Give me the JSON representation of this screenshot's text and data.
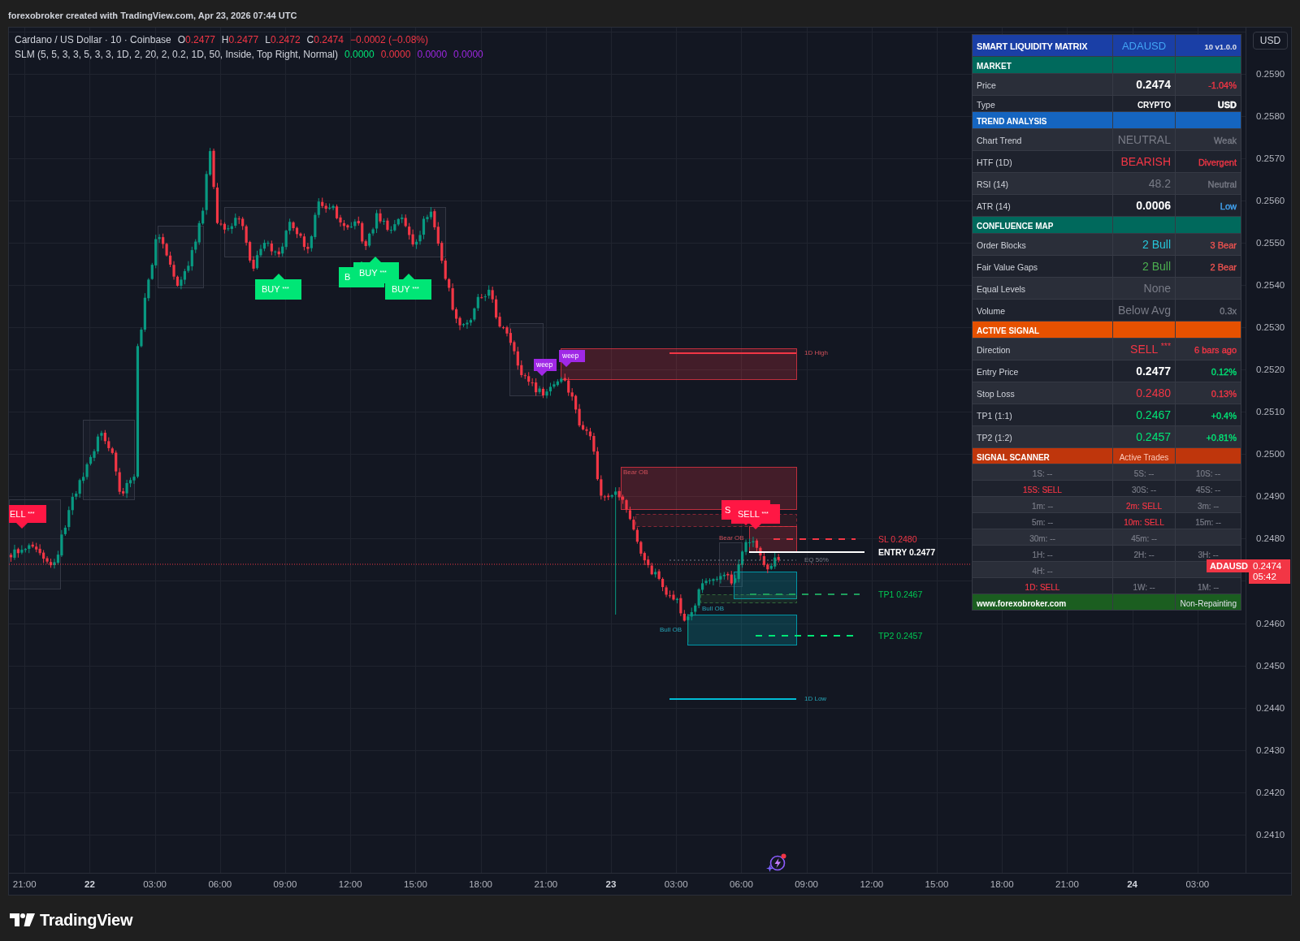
{
  "attribution": "forexobroker created with TradingView.com, Apr 23, 2026 07:44 UTC",
  "legend": {
    "symbol": "Cardano / US Dollar · 10 · Coinbase",
    "bearish": true,
    "ohlc": [
      {
        "key": "O",
        "value": "0.2477"
      },
      {
        "key": "H",
        "value": "0.2477"
      },
      {
        "key": "L",
        "value": "0.2472"
      },
      {
        "key": "C",
        "value": "0.2474"
      }
    ],
    "change": "−0.0002 (−0.08%)",
    "indicator": "SLM (5, 5, 3, 3, 5, 3, 3, 1D, 2, 20, 2, 0.2, 1D, 50, Inside, Top Right, Normal)",
    "indicator_values": [
      {
        "value": "0.0000",
        "color": "#00e676"
      },
      {
        "value": "0.0000",
        "color": "#f23645"
      },
      {
        "value": "0.0000",
        "color": "#9c27e0"
      },
      {
        "value": "0.0000",
        "color": "#9c27e0"
      }
    ]
  },
  "signal_labels": [
    {
      "kind": "sell",
      "text": "ELL $^{***}$"
    },
    {
      "kind": "buy",
      "text": "BUY $^{***}$"
    },
    {
      "kind": "buy",
      "text": "B"
    },
    {
      "kind": "buy",
      "text": "BUY $^{***}$"
    },
    {
      "kind": "buy",
      "text": "BUY $^{***}$"
    },
    {
      "kind": "sweep",
      "text": "weep"
    },
    {
      "kind": "sweep",
      "text": "weep"
    },
    {
      "kind": "sell",
      "text": "S"
    },
    {
      "kind": "sell",
      "text": "SELL $^{***}$"
    }
  ],
  "zone_labels": [
    {
      "kind": "bearish",
      "text": "1D High"
    },
    {
      "kind": "bearish",
      "text": "Bear OB"
    },
    {
      "kind": "bearish",
      "text": "Bear OB"
    },
    {
      "kind": "neutral",
      "text": "EQ 50%"
    },
    {
      "kind": "bullish",
      "text": "Bull OB"
    },
    {
      "kind": "bullish",
      "text": "Bull OB"
    },
    {
      "kind": "bullish",
      "text": "1D Low"
    }
  ],
  "trade_levels": [
    {
      "kind": "stop",
      "text": "SL 0.2480"
    },
    {
      "kind": "entry",
      "text": "ENTRY 0.2477"
    },
    {
      "kind": "target",
      "text": "TP1 0.2467"
    },
    {
      "kind": "target",
      "text": "TP2 0.2457"
    }
  ],
  "dashboard": {
    "title": "SMART LIQUIDITY MATRIX",
    "symbol": "ADAUSD",
    "version": "10 v1.0.0",
    "sections": [
      {
        "title": "MARKET",
        "color": "#00695c",
        "rows": [
          {
            "label": "Price",
            "kind": "metric",
            "value": {
              "text": "0.2474",
              "color": "#ffffff",
              "bold": true
            },
            "note": {
              "text": "-1.04%",
              "color": "#f23645"
            }
          },
          {
            "label": "Type",
            "kind": "info",
            "value": {
              "text": "CRYPTO",
              "color": "#ffffff",
              "bold": true
            },
            "note": {
              "text": "USD",
              "color": "#ffffff"
            }
          }
        ]
      },
      {
        "title": "TREND ANALYSIS",
        "color": "#1565c0",
        "rows": [
          {
            "label": "Chart Trend",
            "kind": "metric",
            "value": {
              "text": "NEUTRAL",
              "color": "#787b86",
              "bold": false
            },
            "note": {
              "text": "Weak",
              "color": "#787b86"
            }
          },
          {
            "label": "HTF (1D)",
            "kind": "metric",
            "value": {
              "text": "BEARISH",
              "color": "#f23645",
              "bold": false
            },
            "note": {
              "text": "Divergent",
              "color": "#f23645"
            }
          },
          {
            "label": "RSI (14)",
            "kind": "metric",
            "value": {
              "text": "48.2",
              "color": "#787b86",
              "bold": false
            },
            "note": {
              "text": "Neutral",
              "color": "#787b86"
            }
          },
          {
            "label": "ATR (14)",
            "kind": "metric",
            "value": {
              "text": "0.0006",
              "color": "#ffffff",
              "bold": true
            },
            "note": {
              "text": "Low",
              "color": "#42a5f5"
            }
          }
        ]
      },
      {
        "title": "CONFLUENCE MAP",
        "color": "#00695c",
        "rows": [
          {
            "label": "Order Blocks",
            "kind": "metric",
            "value": {
              "text": "2 Bull",
              "color": "#26c6da",
              "bold": false
            },
            "note": {
              "text": "3 Bear",
              "color": "#ef5350"
            }
          },
          {
            "label": "Fair Value Gaps",
            "kind": "metric",
            "value": {
              "text": "2 Bull",
              "color": "#4caf50",
              "bold": false
            },
            "note": {
              "text": "2 Bear",
              "color": "#ef5350"
            }
          },
          {
            "label": "Equal Levels",
            "kind": "metric",
            "value": {
              "text": "None",
              "color": "#787b86",
              "bold": false
            }
          },
          {
            "label": "Volume",
            "kind": "metric",
            "value": {
              "text": "Below Avg",
              "color": "#787b86",
              "bold": false
            },
            "note": {
              "text": "0.3x",
              "color": "#787b86"
            }
          }
        ]
      },
      {
        "title": "ACTIVE SIGNAL",
        "color": "#e65100",
        "rows": [
          {
            "label": "Direction",
            "kind": "metric",
            "value": {
              "text": "SELL $^{***}$",
              "color": "#f23645",
              "bold": false
            },
            "note": {
              "text": "6 bars ago",
              "color": "#f23645"
            }
          },
          {
            "label": "Entry Price",
            "kind": "metric",
            "value": {
              "text": "0.2477",
              "color": "#ffffff",
              "bold": true
            },
            "note": {
              "text": "0.12%",
              "color": "#00e676"
            }
          },
          {
            "label": "Stop Loss",
            "kind": "metric",
            "value": {
              "text": "0.2480",
              "color": "#f23645",
              "bold": false
            },
            "note": {
              "text": "0.13%",
              "color": "#f23645"
            }
          },
          {
            "label": "TP1 (1:1)",
            "kind": "metric",
            "value": {
              "text": "0.2467",
              "color": "#00e676",
              "bold": false
            },
            "note": {
              "text": "+0.4%",
              "color": "#00e676"
            }
          },
          {
            "label": "TP2 (1:2)",
            "kind": "metric",
            "value": {
              "text": "0.2457",
              "color": "#00e676",
              "bold": false
            },
            "note": {
              "text": "+0.81%",
              "color": "#00e676"
            }
          }
        ]
      },
      {
        "title": "SIGNAL SCANNER",
        "subtitle": "Active Trades",
        "color": "#bf360c",
        "scanner": [
          [
            {
              "text": "1S: --",
              "color": "#787b86"
            },
            {
              "text": "5S: --",
              "color": "#787b86"
            },
            {
              "text": "10S: --",
              "color": "#787b86"
            }
          ],
          [
            {
              "text": "15S: SELL",
              "color": "#f23645"
            },
            {
              "text": "30S: --",
              "color": "#787b86"
            },
            {
              "text": "45S: --",
              "color": "#787b86"
            }
          ],
          [
            {
              "text": "1m: --",
              "color": "#787b86"
            },
            {
              "text": "2m: SELL",
              "color": "#f23645"
            },
            {
              "text": "3m: --",
              "color": "#787b86"
            }
          ],
          [
            {
              "text": "5m: --",
              "color": "#787b86"
            },
            {
              "text": "10m: SELL",
              "color": "#f23645"
            },
            {
              "text": "15m: --",
              "color": "#787b86"
            }
          ],
          [
            {
              "text": "30m: --",
              "color": "#787b86"
            },
            {
              "text": "45m: --",
              "color": "#787b86"
            }
          ],
          [
            {
              "text": "1H: --",
              "color": "#787b86"
            },
            {
              "text": "2H: --",
              "color": "#787b86"
            },
            {
              "text": "3H: --",
              "color": "#787b86"
            }
          ],
          [
            {
              "text": "4H: --",
              "color": "#787b86"
            }
          ],
          [
            {
              "text": "1D: SELL",
              "color": "#f23645"
            },
            {
              "text": "1W: --",
              "color": "#787b86"
            },
            {
              "text": "1M: --",
              "color": "#787b86"
            }
          ]
        ]
      }
    ],
    "footer": {
      "left": "www.forexobroker.com",
      "right": "Non-Repainting"
    }
  },
  "price_axis": {
    "currency": "USD",
    "labels": [
      "0.2590",
      "0.2580",
      "0.2570",
      "0.2560",
      "0.2550",
      "0.2540",
      "0.2530",
      "0.2520",
      "0.2510",
      "0.2500",
      "0.2490",
      "0.2480",
      "0.2460",
      "0.2450",
      "0.2440",
      "0.2430",
      "0.2420",
      "0.2410"
    ],
    "symbol_tag": "ADAUSD",
    "price": "0.2474",
    "countdown": "05:42"
  },
  "time_axis": {
    "labels": [
      {
        "text": "21:00",
        "kind": "time"
      },
      {
        "text": "22",
        "kind": "day"
      },
      {
        "text": "03:00",
        "kind": "time"
      },
      {
        "text": "06:00",
        "kind": "time"
      },
      {
        "text": "09:00",
        "kind": "time"
      },
      {
        "text": "12:00",
        "kind": "time"
      },
      {
        "text": "15:00",
        "kind": "time"
      },
      {
        "text": "18:00",
        "kind": "time"
      },
      {
        "text": "21:00",
        "kind": "time"
      },
      {
        "text": "23",
        "kind": "day"
      },
      {
        "text": "03:00",
        "kind": "time"
      },
      {
        "text": "06:00",
        "kind": "time"
      },
      {
        "text": "09:00",
        "kind": "time"
      },
      {
        "text": "12:00",
        "kind": "time"
      },
      {
        "text": "15:00",
        "kind": "time"
      },
      {
        "text": "18:00",
        "kind": "time"
      },
      {
        "text": "21:00",
        "kind": "time"
      },
      {
        "text": "24",
        "kind": "day"
      },
      {
        "text": "03:00",
        "kind": "time"
      }
    ]
  },
  "brand": "TradingView"
}
